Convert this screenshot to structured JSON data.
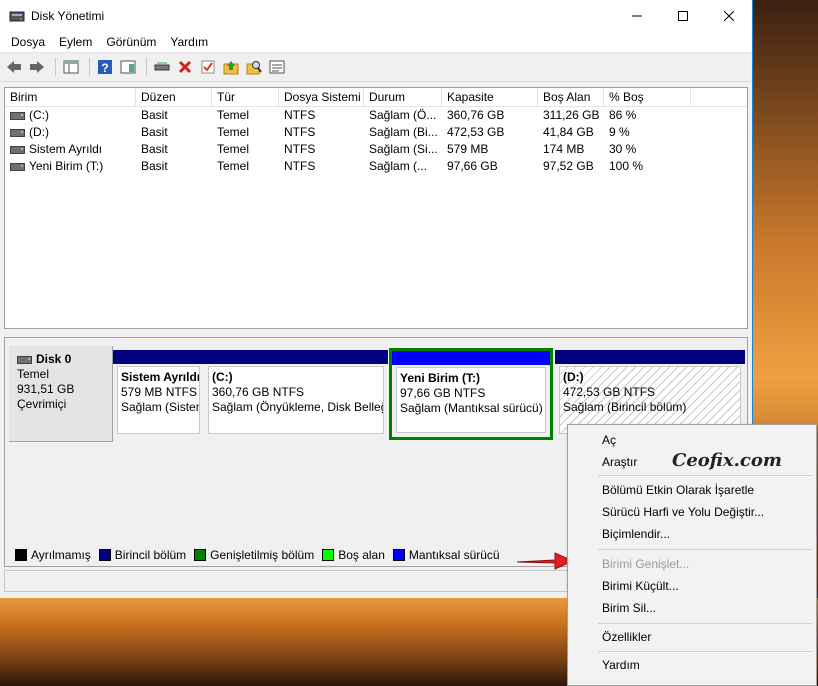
{
  "window": {
    "title": "Disk Yönetimi"
  },
  "menu": [
    "Dosya",
    "Eylem",
    "Görünüm",
    "Yardım"
  ],
  "table": {
    "headers": [
      "Birim",
      "Düzen",
      "Tür",
      "Dosya Sistemi",
      "Durum",
      "Kapasite",
      "Boş Alan",
      "% Boş"
    ],
    "rows": [
      [
        "(C:)",
        "Basit",
        "Temel",
        "NTFS",
        "Sağlam (Ö...",
        "360,76 GB",
        "311,26 GB",
        "86 %"
      ],
      [
        "(D:)",
        "Basit",
        "Temel",
        "NTFS",
        "Sağlam (Bi...",
        "472,53 GB",
        "41,84 GB",
        "9 %"
      ],
      [
        "Sistem Ayrıldı",
        "Basit",
        "Temel",
        "NTFS",
        "Sağlam (Si...",
        "579 MB",
        "174 MB",
        "30 %"
      ],
      [
        "Yeni Birim (T:)",
        "Basit",
        "Temel",
        "NTFS",
        "Sağlam (...",
        "97,66 GB",
        "97,52 GB",
        "100 %"
      ]
    ]
  },
  "disk": {
    "name": "Disk 0",
    "type": "Temel",
    "size": "931,51 GB",
    "status": "Çevrimiçi"
  },
  "partitions": [
    {
      "name": "Sistem Ayrıldı",
      "size": "579 MB NTFS",
      "status": "Sağlam (Sisten"
    },
    {
      "name": "(C:)",
      "size": "360,76 GB NTFS",
      "status": "Sağlam (Önyükleme, Disk Belleğ"
    },
    {
      "name": "Yeni Birim  (T:)",
      "size": "97,66 GB NTFS",
      "status": "Sağlam (Mantıksal sürücü)"
    },
    {
      "name": "(D:)",
      "size": "472,53 GB NTFS",
      "status": "Sağlam (Birincil bölüm)"
    }
  ],
  "legend": [
    "Ayrılmamış",
    "Birincil bölüm",
    "Genişletilmiş bölüm",
    "Boş alan",
    "Mantıksal sürücü"
  ],
  "legend_colors": [
    "#000000",
    "#000080",
    "#008000",
    "#00ff00",
    "#0000ff"
  ],
  "context_menu": {
    "items": [
      "Aç",
      "Araştır",
      "Bölümü Etkin Olarak İşaretle",
      "Sürücü Harfi ve Yolu Değiştir...",
      "Biçimlendir...",
      "Birimi Genişlet...",
      "Birimi Küçült...",
      "Birim Sil...",
      "Özellikler",
      "Yardım"
    ],
    "disabled": "Birimi Genişlet..."
  },
  "watermark": "Ceofix.com",
  "colors": {
    "primary_bar": "#000080",
    "logical_bar": "#0000ff",
    "selected_border": "#008000",
    "arrow": "#e02020"
  }
}
